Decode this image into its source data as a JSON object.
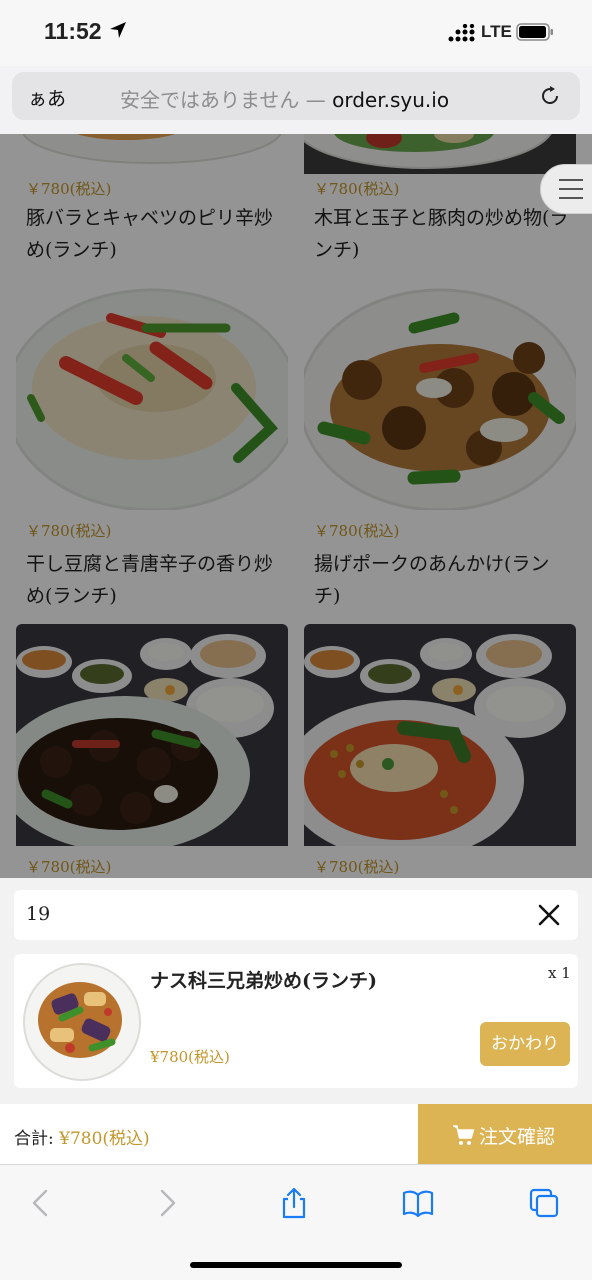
{
  "status_bar": {
    "time": "11:52",
    "network": "LTE"
  },
  "url_bar": {
    "text_size": "ぁあ",
    "security": "安全ではありません",
    "separator": " — ",
    "domain": "order.syu.io"
  },
  "menu": {
    "cards": [
      {
        "price": "￥780(税込)",
        "name": "豚バラとキャベツのピリ辛炒め(ランチ)"
      },
      {
        "price": "￥780(税込)",
        "name": "木耳と玉子と豚肉の炒め物(ランチ)"
      },
      {
        "price": "￥780(税込)",
        "name": "干し豆腐と青唐辛子の香り炒め(ランチ)"
      },
      {
        "price": "￥780(税込)",
        "name": "揚げポークのあんかけ(ランチ)"
      },
      {
        "price": "￥780(税込)",
        "name": ""
      },
      {
        "price": "￥780(税込)",
        "name": ""
      }
    ]
  },
  "cart": {
    "quantity_field": "19",
    "item": {
      "name": "ナス科三兄弟炒め(ランチ)",
      "count": "x 1",
      "price": "¥780(税込)",
      "again_label": "おかわり"
    }
  },
  "order_bar": {
    "total_label": "合計: ",
    "total_amount": "¥780(税込)",
    "confirm_label": "注文確認"
  },
  "colors": {
    "accent": "#dcb454",
    "price": "#c2962a",
    "ios_blue": "#1a7cf5"
  },
  "icons": [
    "location-arrow-icon",
    "signal-icon",
    "battery-icon",
    "reload-icon",
    "menu-list-icon",
    "close-icon",
    "cart-icon",
    "back-icon",
    "forward-icon",
    "share-icon",
    "bookmarks-icon",
    "tabs-icon"
  ]
}
